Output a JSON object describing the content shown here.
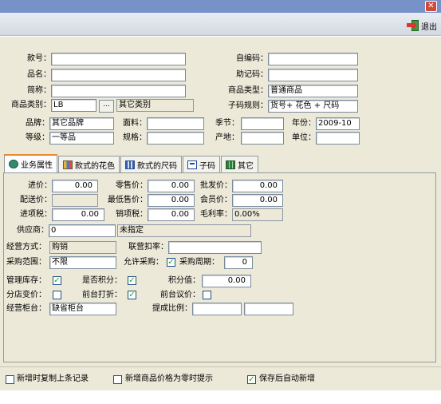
{
  "window": {
    "close_glyph": "✕"
  },
  "toolbar": {
    "exit_label": "退出"
  },
  "header": {
    "style_no": {
      "label": "款号：",
      "value": ""
    },
    "name": {
      "label": "品名：",
      "value": ""
    },
    "short_name": {
      "label": "简称：",
      "value": ""
    },
    "category": {
      "label": "商品类别：",
      "code": "LB",
      "button": "...",
      "name": "其它类别"
    },
    "brand": {
      "label": "品牌：",
      "value": "其它品牌"
    },
    "grade": {
      "label": "等级：",
      "value": "一等品"
    },
    "fabric": {
      "label": "面料：",
      "value": ""
    },
    "spec": {
      "label": "规格：",
      "value": ""
    },
    "self_code": {
      "label": "自编码：",
      "value": ""
    },
    "mnemonic": {
      "label": "助记码：",
      "value": ""
    },
    "product_type": {
      "label": "商品类型：",
      "value": "普通商品"
    },
    "subcode_rule": {
      "label": "子码规则：",
      "value": "货号+ 花色 + 尺码"
    },
    "season": {
      "label": "季节：",
      "value": ""
    },
    "origin": {
      "label": "产地：",
      "value": ""
    },
    "year": {
      "label": "年份：",
      "value": "2009-10"
    },
    "unit": {
      "label": "单位：",
      "value": ""
    }
  },
  "tabs": [
    {
      "label": "业务属性",
      "icon": "business-icon",
      "active": true
    },
    {
      "label": "款式的花色",
      "icon": "color-palette-icon",
      "active": false
    },
    {
      "label": "款式的尺码",
      "icon": "size-grid-icon",
      "active": false
    },
    {
      "label": "子码",
      "icon": "subcode-icon",
      "active": false
    },
    {
      "label": "其它",
      "icon": "other-icon",
      "active": false
    }
  ],
  "business": {
    "purchase_price": {
      "label": "进价：",
      "value": "0.00"
    },
    "retail_price": {
      "label": "零售价：",
      "value": "0.00"
    },
    "wholesale_price": {
      "label": "批发价：",
      "value": "0.00"
    },
    "delivery_price": {
      "label": "配送价：",
      "value": ""
    },
    "min_price": {
      "label": "最低售价：",
      "value": "0.00"
    },
    "member_price": {
      "label": "会员价：",
      "value": "0.00"
    },
    "input_tax": {
      "label": "进项税：",
      "value": "0.00"
    },
    "output_tax": {
      "label": "销项税：",
      "value": "0.00"
    },
    "gross_margin": {
      "label": "毛利率：",
      "value": "0.00%"
    },
    "supplier": {
      "label": "供应商：",
      "code": "0",
      "name": "未指定"
    },
    "business_mode": {
      "label": "经营方式：",
      "value": "购销"
    },
    "joint_rate": {
      "label": "联营扣率：",
      "value": ""
    },
    "purchase_scope": {
      "label": "采购范围：",
      "value": "不限"
    },
    "allow_purchase": {
      "label": "允许采购：",
      "checked": true
    },
    "purchase_cycle": {
      "label": "采购周期：",
      "value": "0"
    },
    "manage_stock": {
      "label": "管理库存：",
      "checked": true
    },
    "earn_points": {
      "label": "是否积分：",
      "checked": true
    },
    "points_value": {
      "label": "积分值：",
      "value": "0.00"
    },
    "store_price_change": {
      "label": "分店变价：",
      "checked": false
    },
    "front_discount": {
      "label": "前台打折：",
      "checked": true
    },
    "front_negotiate": {
      "label": "前台议价：",
      "checked": false
    },
    "counter": {
      "label": "经营柜台：",
      "value": "缺省柜台"
    },
    "commission": {
      "label": "提成比例：",
      "value1": "",
      "value2": ""
    }
  },
  "footer": {
    "copy_last": {
      "label": "新增时复制上条记录",
      "checked": false
    },
    "price_zero_hint": {
      "label": "新增商品价格为零时提示",
      "checked": false
    },
    "auto_new": {
      "label": "保存后自动新增",
      "checked": true
    }
  },
  "check_glyph": "✓"
}
